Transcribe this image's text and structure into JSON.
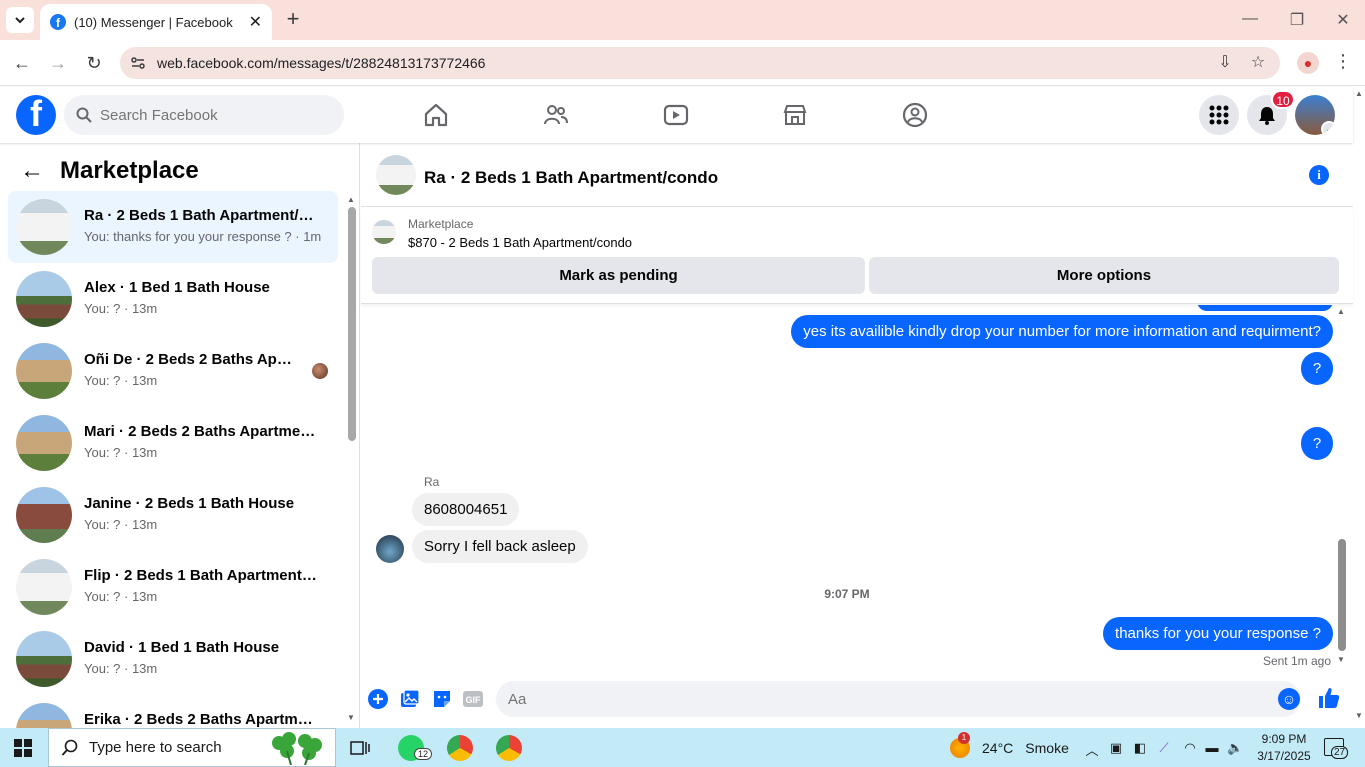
{
  "browser": {
    "tab_title": "(10) Messenger | Facebook",
    "url": "web.facebook.com/messages/t/28824813173772466"
  },
  "fbnav": {
    "search_placeholder": "Search Facebook",
    "notification_count": "10"
  },
  "left_panel": {
    "title": "Marketplace",
    "conversations": [
      {
        "name": "Ra · 2 Beds 1 Bath Apartment/condo",
        "preview": "You: thanks for you your response ? · 1m",
        "thumb": "t-white",
        "active": true
      },
      {
        "name": "Alex · 1 Bed 1 Bath House",
        "preview": "You: ? · 13m",
        "thumb": "t-house"
      },
      {
        "name": "Oñi De · 2 Beds 2 Baths Apartment",
        "preview": "You: ? · 13m",
        "thumb": "t-condo",
        "seen": true
      },
      {
        "name": "Mari · 2 Beds 2 Baths Apartment/condo",
        "preview": "You: ? · 13m",
        "thumb": "t-condo"
      },
      {
        "name": "Janine · 2 Beds 1 Bath House",
        "preview": "You: ? · 13m",
        "thumb": "t-brick"
      },
      {
        "name": "Flip · 2 Beds 1 Bath Apartment/condo",
        "preview": "You: ? · 13m",
        "thumb": "t-white"
      },
      {
        "name": "David · 1 Bed 1 Bath House",
        "preview": "You: ? · 13m",
        "thumb": "t-house"
      },
      {
        "name": "Erika · 2 Beds 2 Baths Apartment/condo",
        "preview": "",
        "thumb": "t-condo"
      }
    ]
  },
  "chat": {
    "title": "Ra · 2 Beds 1 Bath Apartment/condo",
    "listing_label": "Marketplace",
    "listing_detail": "$870 - 2 Beds 1 Bath Apartment/condo",
    "mark_pending_label": "Mark as pending",
    "more_options_label": "More options",
    "messages": {
      "out_1": "yes its availible kindly drop your number for more information and requirment?",
      "out_2": "?",
      "out_3": "?",
      "sender": "Ra",
      "in_1": "8608004651",
      "in_2": "Sorry I fell back asleep",
      "time_separator": "9:07 PM",
      "out_4": "thanks for you your response ?",
      "status": "Sent 1m ago"
    },
    "composer_placeholder": "Aa"
  },
  "taskbar": {
    "search_label": "Type here to search",
    "whatsapp_badge": "12",
    "weather_temp": "24°C",
    "weather_desc": "Smoke",
    "weather_alert": "1",
    "time": "9:09 PM",
    "date": "3/17/2025",
    "notification_count": "27"
  },
  "colors": {
    "accent": "#0866ff",
    "tabbar": "#f9e0db",
    "taskbar": "#c2eaf7"
  }
}
